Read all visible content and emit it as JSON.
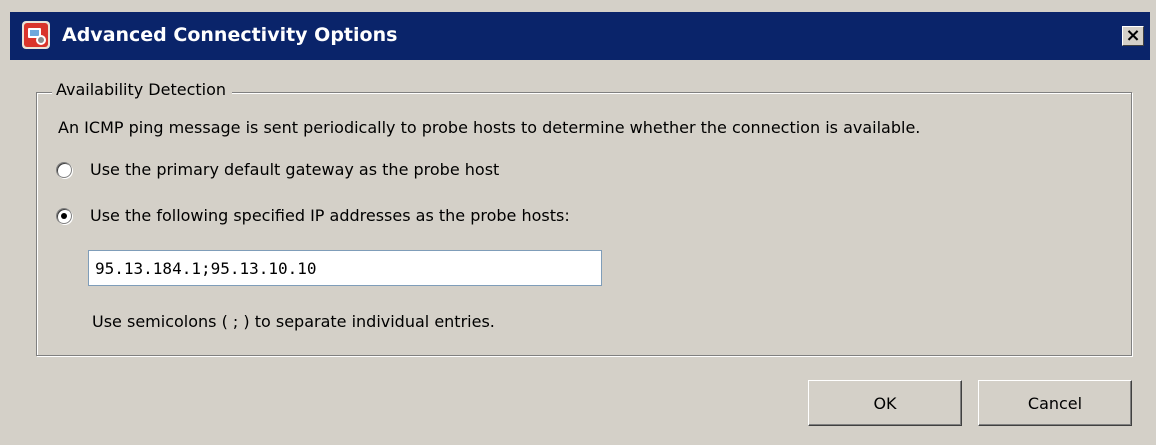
{
  "window": {
    "title": "Advanced Connectivity Options",
    "close_label": "×"
  },
  "availability": {
    "group_title": "Availability Detection",
    "description": "An ICMP ping message is sent periodically to probe hosts to determine whether the connection is available.",
    "options": [
      {
        "label": "Use the primary default gateway as the probe host",
        "selected": false
      },
      {
        "label": "Use the following specified IP addresses as the probe hosts:",
        "selected": true
      }
    ],
    "ip_addresses_value": "95.13.184.1;95.13.10.10",
    "hint": "Use semicolons ( ; ) to separate individual entries."
  },
  "buttons": {
    "ok": "OK",
    "cancel": "Cancel"
  },
  "colors": {
    "titlebar": "#0a246a",
    "dialog_background": "#d4d0c8"
  }
}
